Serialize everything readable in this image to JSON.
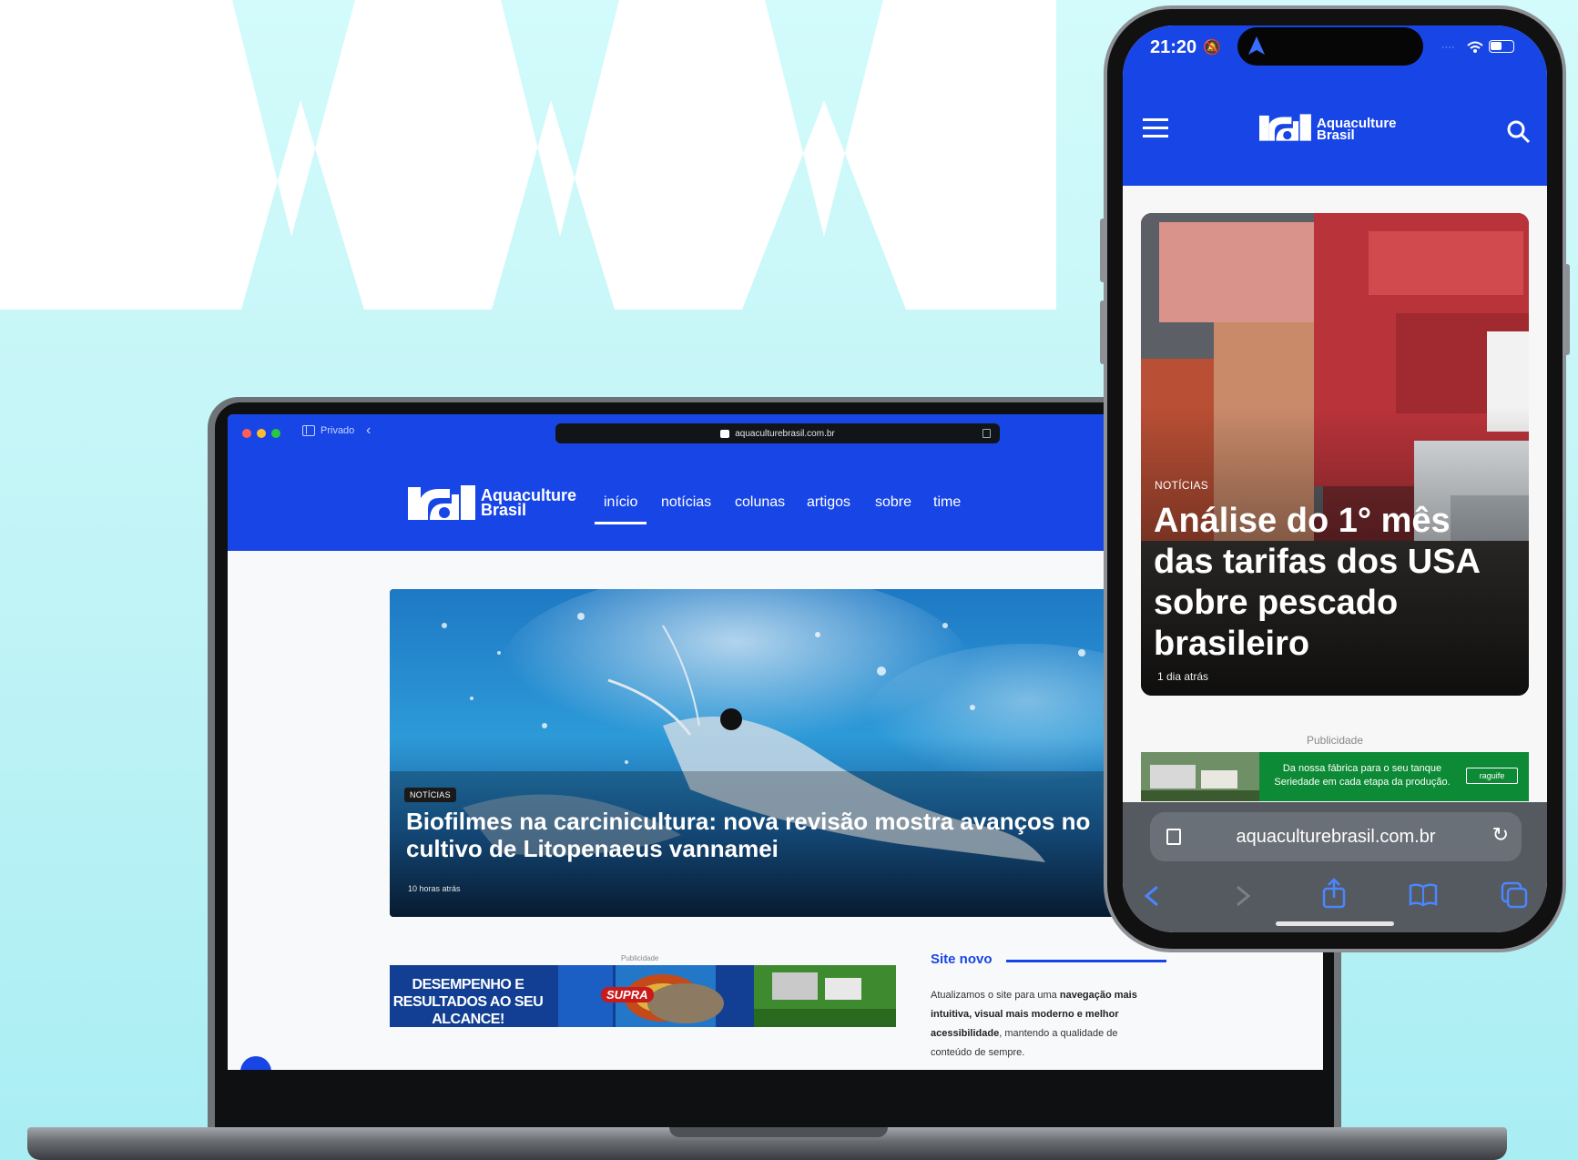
{
  "laptop": {
    "browser": {
      "private_label": "Privado",
      "url": "aquaculturebrasil.com.br"
    },
    "site": {
      "logo_line1": "Aquaculture",
      "logo_line2": "Brasil",
      "nav": [
        {
          "label": "início",
          "active": true
        },
        {
          "label": "notícias"
        },
        {
          "label": "colunas"
        },
        {
          "label": "artigos"
        },
        {
          "label": "sobre"
        },
        {
          "label": "time"
        }
      ],
      "hero": {
        "badge": "NOTÍCIAS",
        "title": "Biofilmes na carcinicultura: nova revisão mostra avanços no cultivo de Litopenaeus vannamei",
        "time": "10 horas atrás"
      },
      "ad": {
        "label": "Publicidade",
        "text": "DESEMPENHO E RESULTADOS AO SEU ALCANCE!",
        "brand": "SUPRA"
      },
      "site_novo": {
        "title": "Site novo",
        "p1": "Atualizamos o site para uma ",
        "b1": "navegação mais intuitiva, visual mais moderno e melhor acessibilidade",
        "p2": ", mantendo a qualidade de conteúdo de sempre."
      }
    }
  },
  "phone": {
    "status": {
      "time": "21:20"
    },
    "site": {
      "logo_line1": "Aquaculture",
      "logo_line2": "Brasil"
    },
    "card": {
      "badge": "NOTÍCIAS",
      "title": "Análise do 1° mês das tarifas dos USA sobre pescado brasileiro",
      "time": "1 dia atrás"
    },
    "ad": {
      "label": "Publicidade",
      "line1": "Da nossa fábrica para o seu tanque",
      "line2": "Seriedade em cada etapa da produção.",
      "brand": "raguife"
    },
    "url": "aquaculturebrasil.com.br"
  },
  "colors": {
    "brand_blue": "#1846e6",
    "background": "#c8f6f8",
    "ad_green": "#0d8a36"
  },
  "icons": [
    "menu-icon",
    "search-icon",
    "reload-icon",
    "reader-icon",
    "back-icon",
    "forward-icon",
    "share-icon",
    "bookmarks-icon",
    "tabs-icon",
    "location-icon",
    "bell-off-icon",
    "wifi-icon",
    "battery-icon",
    "accessibility-icon"
  ]
}
